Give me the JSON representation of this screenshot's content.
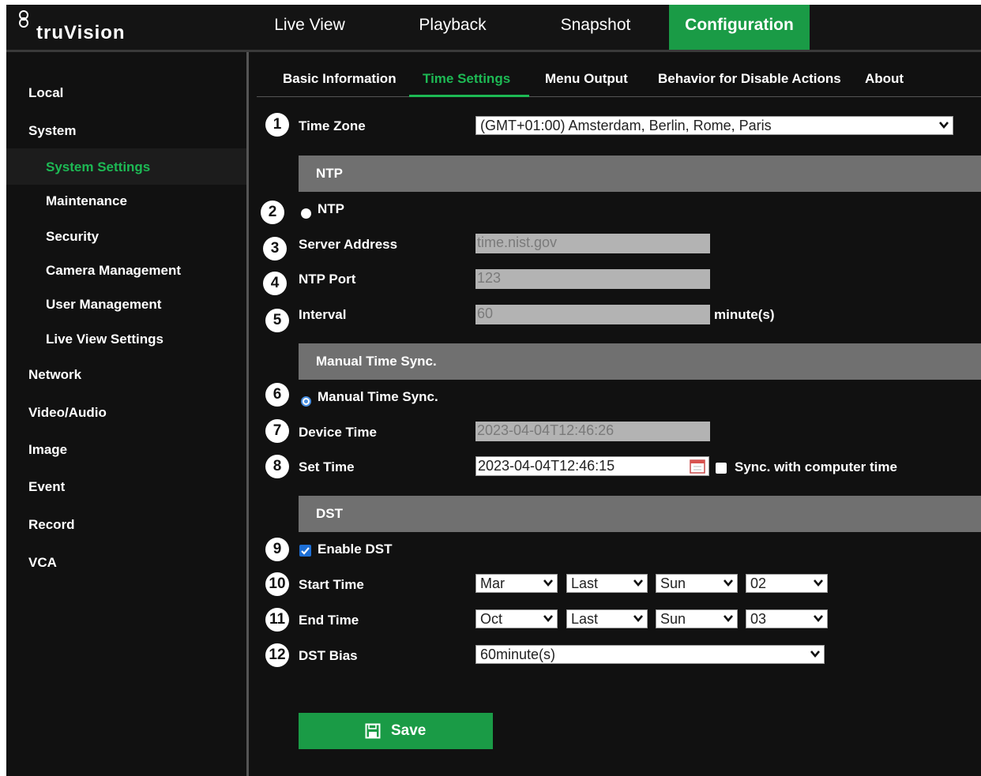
{
  "brand": {
    "logo_text": "truVision"
  },
  "top_nav": {
    "live_view": "Live View",
    "playback": "Playback",
    "snapshot": "Snapshot",
    "configuration": "Configuration"
  },
  "sidebar": {
    "local": "Local",
    "system": "System",
    "system_settings": "System Settings",
    "maintenance": "Maintenance",
    "security": "Security",
    "camera_management": "Camera Management",
    "user_management": "User Management",
    "live_view_settings": "Live View Settings",
    "network": "Network",
    "video_audio": "Video/Audio",
    "image": "Image",
    "event": "Event",
    "record": "Record",
    "vca": "VCA"
  },
  "subtabs": {
    "basic_information": "Basic Information",
    "time_settings": "Time Settings",
    "menu_output": "Menu Output",
    "behavior": "Behavior for Disable Actions",
    "about": "About"
  },
  "callouts": [
    "1",
    "2",
    "3",
    "4",
    "5",
    "6",
    "7",
    "8",
    "9",
    "10",
    "11",
    "12"
  ],
  "form": {
    "time_zone_label": "Time Zone",
    "time_zone_value": "(GMT+01:00) Amsterdam, Berlin, Rome, Paris",
    "ntp_section": "NTP",
    "ntp_radio_label": "NTP",
    "server_address_label": "Server Address",
    "server_address_value": "time.nist.gov",
    "ntp_port_label": "NTP Port",
    "ntp_port_value": "123",
    "interval_label": "Interval",
    "interval_value": "60",
    "interval_unit": "minute(s)",
    "manual_section": "Manual Time Sync.",
    "manual_radio_label": "Manual Time Sync.",
    "device_time_label": "Device Time",
    "device_time_value": "2023-04-04T12:46:26",
    "set_time_label": "Set Time",
    "set_time_value": "2023-04-04T12:46:15",
    "sync_computer_label": "Sync. with computer time",
    "dst_section": "DST",
    "enable_dst_label": "Enable DST",
    "start_time_label": "Start Time",
    "start_month": "Mar",
    "start_week": "Last",
    "start_day": "Sun",
    "start_hour": "02",
    "end_time_label": "End Time",
    "end_month": "Oct",
    "end_week": "Last",
    "end_day": "Sun",
    "end_hour": "03",
    "dst_bias_label": "DST Bias",
    "dst_bias_value": "60minute(s)",
    "save_label": "Save"
  },
  "state": {
    "ntp_selected": false,
    "manual_selected": true,
    "sync_with_computer": false,
    "enable_dst": true
  },
  "colors": {
    "accent_green": "#1a9b46",
    "active_text_green": "#1db954",
    "section_gray": "#707070",
    "checkbox_blue": "#1d6fd6"
  }
}
